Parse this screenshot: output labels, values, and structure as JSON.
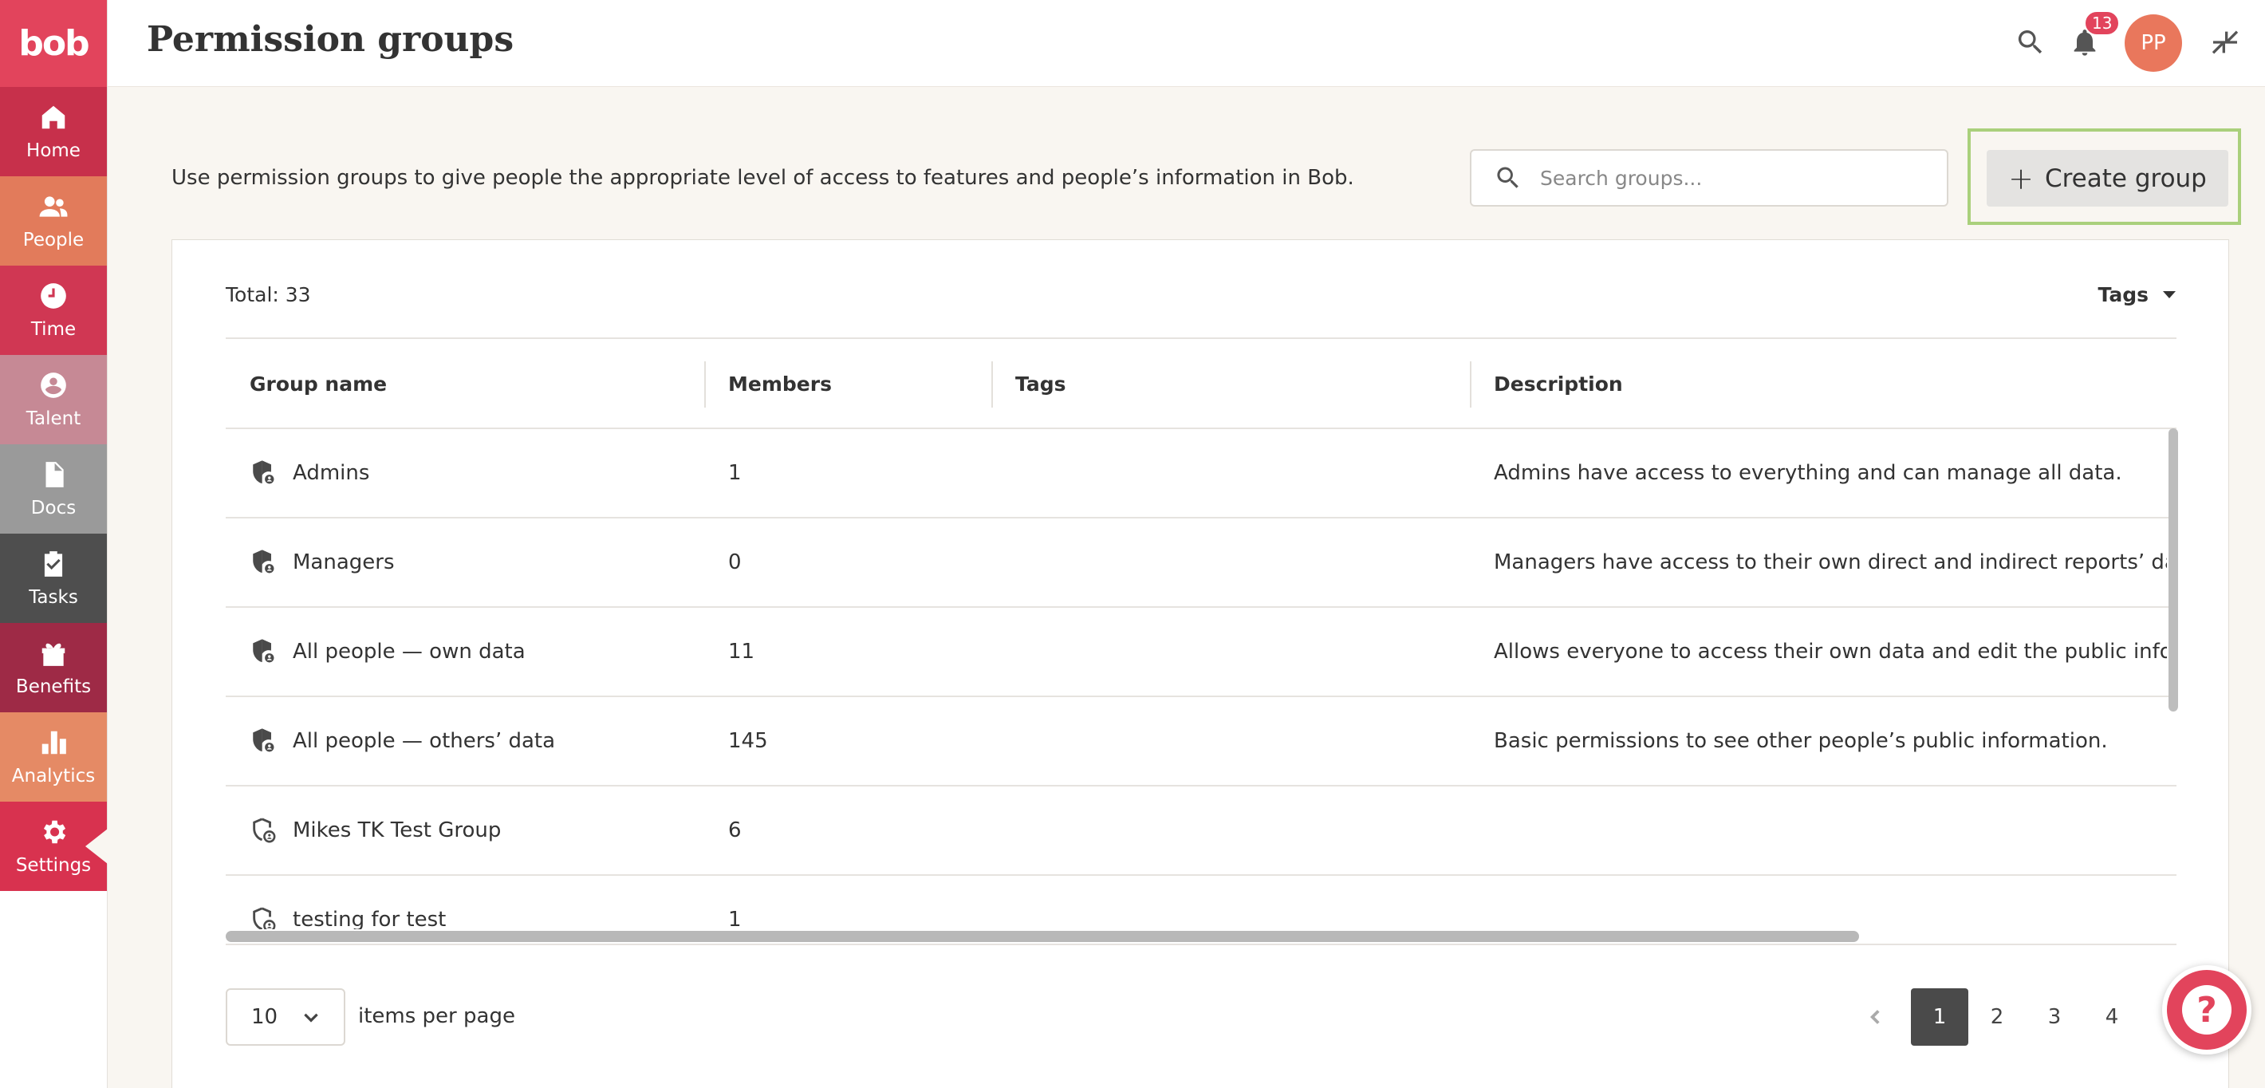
{
  "app": {
    "logo": "bob"
  },
  "sidebar": {
    "items": [
      {
        "label": "Home",
        "icon": "home-icon",
        "color": "#c7304b"
      },
      {
        "label": "People",
        "icon": "people-icon",
        "color": "#e27b5b"
      },
      {
        "label": "Time",
        "icon": "clock-icon",
        "color": "#d03753"
      },
      {
        "label": "Talent",
        "icon": "talent-icon",
        "color": "#c68995"
      },
      {
        "label": "Docs",
        "icon": "document-icon",
        "color": "#9a9a9a"
      },
      {
        "label": "Tasks",
        "icon": "clipboard-check-icon",
        "color": "#4e4e4e"
      },
      {
        "label": "Benefits",
        "icon": "gift-icon",
        "color": "#9e2a46"
      },
      {
        "label": "Analytics",
        "icon": "bar-chart-icon",
        "color": "#e58a65"
      },
      {
        "label": "Settings",
        "icon": "gear-icon",
        "color": "#d8324f"
      }
    ]
  },
  "header": {
    "title": "Permission groups",
    "notifications_count": "13",
    "avatar_initials": "PP"
  },
  "intro": "Use permission groups to give people the appropriate level of access to features and people’s information in Bob.",
  "search": {
    "placeholder": "Search groups..."
  },
  "create_button": {
    "label": "Create group"
  },
  "table": {
    "total": "Total: 33",
    "tags_filter": "Tags",
    "columns": [
      "Group name",
      "Members",
      "Tags",
      "Description"
    ],
    "rows": [
      {
        "name": "Admins",
        "members": "1",
        "tags": "",
        "description": "Admins have access to everything and can manage all data.",
        "icon": "shield-filled-icon"
      },
      {
        "name": "Managers",
        "members": "0",
        "tags": "",
        "description": "Managers have access to their own direct and indirect reports’ data",
        "icon": "shield-filled-icon"
      },
      {
        "name": "All people — own data",
        "members": "11",
        "tags": "",
        "description": "Allows everyone to access their own data and edit the public inform",
        "icon": "shield-filled-icon"
      },
      {
        "name": "All people — others’ data",
        "members": "145",
        "tags": "",
        "description": "Basic permissions to see other people’s public information.",
        "icon": "shield-filled-icon"
      },
      {
        "name": "Mikes TK Test Group",
        "members": "6",
        "tags": "",
        "description": "",
        "icon": "shield-outline-icon"
      },
      {
        "name": "testing for test",
        "members": "1",
        "tags": "",
        "description": "",
        "icon": "shield-outline-icon"
      }
    ]
  },
  "pagination": {
    "per_page_value": "10",
    "per_page_label": "items per page",
    "pages": [
      "1",
      "2",
      "3",
      "4"
    ],
    "current": "1"
  }
}
